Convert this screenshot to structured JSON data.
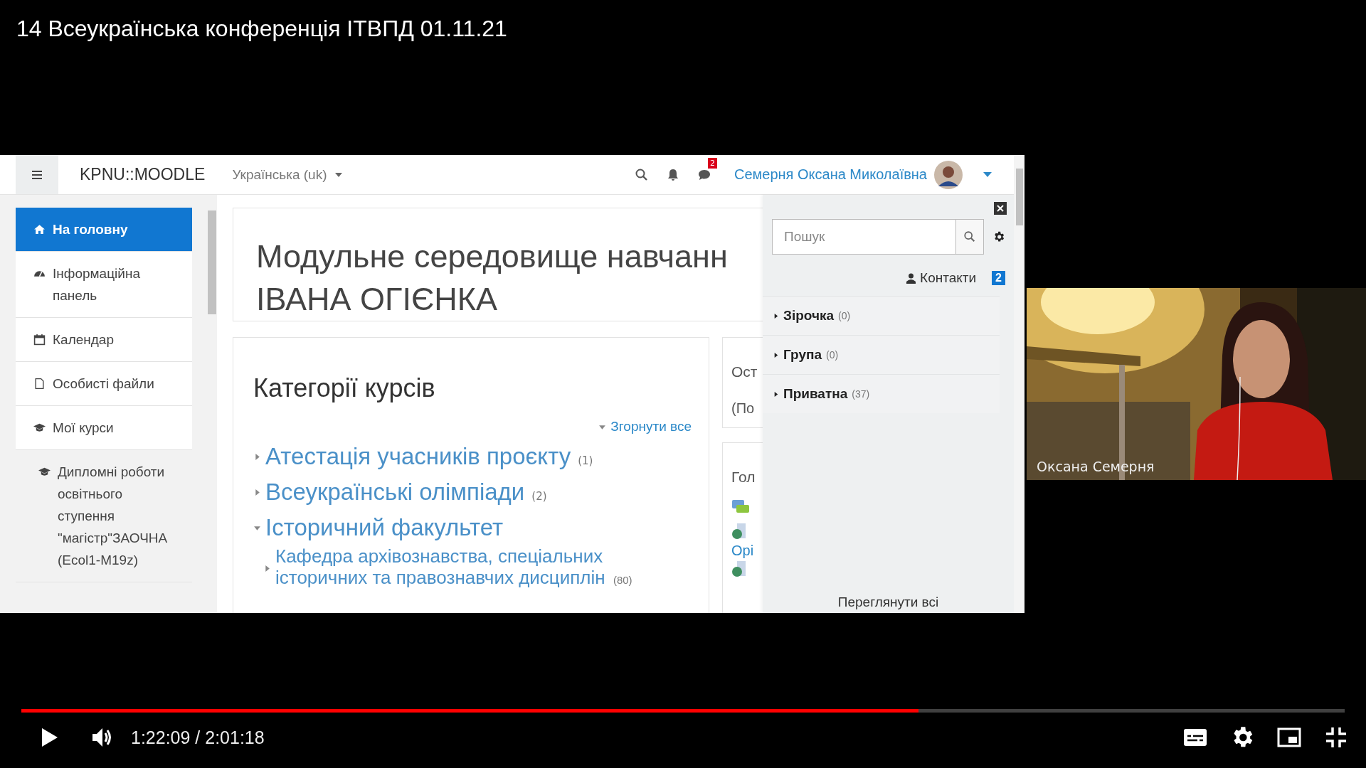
{
  "video_title": "14 Всеукраїнська конференція ІТВПД 01.11.21",
  "moodle": {
    "navbar": {
      "site_name": "KPNU::MOODLE",
      "language": "Українська (uk)",
      "messages_badge": "2",
      "user_name": "Семерня Оксана Миколаївна"
    },
    "sidebar": {
      "items": [
        {
          "label": "На головну",
          "kind": "home",
          "selected": true
        },
        {
          "label": "Інформаційна панель",
          "kind": "dashboard",
          "selected": false
        },
        {
          "label": "Календар",
          "kind": "calendar",
          "selected": false
        },
        {
          "label": "Особисті файли",
          "kind": "file",
          "selected": false
        },
        {
          "label": "Мої курси",
          "kind": "courses",
          "selected": false
        },
        {
          "label": "Дипломні роботи освітнього ступення \"магістр\"ЗАОЧНА (Ecol1-M19z)",
          "kind": "course",
          "selected": false
        }
      ]
    },
    "page_title": [
      "Модульне середовище навчанн",
      "ІВАНА ОГІЄНКА"
    ],
    "course_categories": {
      "title": "Категорії курсів",
      "collapse_all": "Згорнути все",
      "items": [
        {
          "label": "Атестація учасників проєкту",
          "count": "(1)",
          "expanded": false
        },
        {
          "label": "Всеукраїнські олімпіади",
          "count": "(2)",
          "expanded": false
        },
        {
          "label": "Історичний факультет",
          "expanded": true,
          "children": [
            {
              "label": "Кафедра архівознавства, спеціальних історичних та правознавчих дисциплін",
              "count": "(80)",
              "expanded": false
            }
          ]
        }
      ]
    },
    "side_blocks": [
      {
        "title": "Ост",
        "text": "(По"
      },
      {
        "title": "Гол",
        "text": "Орі"
      }
    ],
    "drawer": {
      "search_placeholder": "Пошук",
      "contacts_label": "Контакти",
      "contacts_count": "2",
      "groups": [
        {
          "label": "Зірочка",
          "count": "(0)",
          "expanded": false
        },
        {
          "label": "Група",
          "count": "(0)",
          "expanded": false
        },
        {
          "label": "Приватна",
          "count": "(37)",
          "expanded": false
        }
      ],
      "view_all": "Переглянути всі"
    }
  },
  "webcam": {
    "participant_name": "Оксана Семерня"
  },
  "player": {
    "level": 0.678,
    "time": "1:22:09 / 2:01:18"
  }
}
